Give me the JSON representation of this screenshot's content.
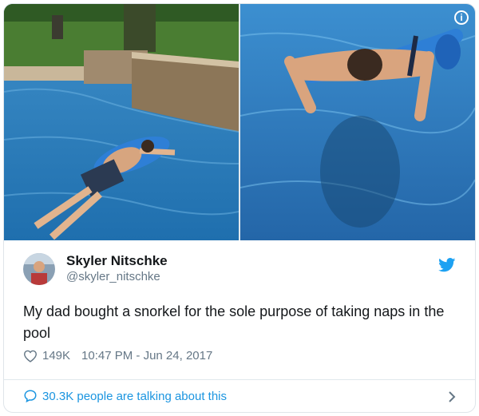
{
  "tweet": {
    "display_name": "Skyler Nitschke",
    "handle": "@skyler_nitschke",
    "text": "My dad bought a snorkel for the sole purpose of taking naps in the pool",
    "likes": "149K",
    "timestamp": "10:47 PM - Jun 24, 2017",
    "talking": "30.3K people are talking about this"
  },
  "icons": {
    "info": "info-icon",
    "bird": "twitter-bird-icon",
    "heart": "heart-icon",
    "bubble": "speech-bubble-icon",
    "chevron": "chevron-right-icon"
  },
  "colors": {
    "accent": "#1da1f2",
    "link": "#1b95e0",
    "secondary_text": "#657786",
    "primary_text": "#14171a"
  }
}
